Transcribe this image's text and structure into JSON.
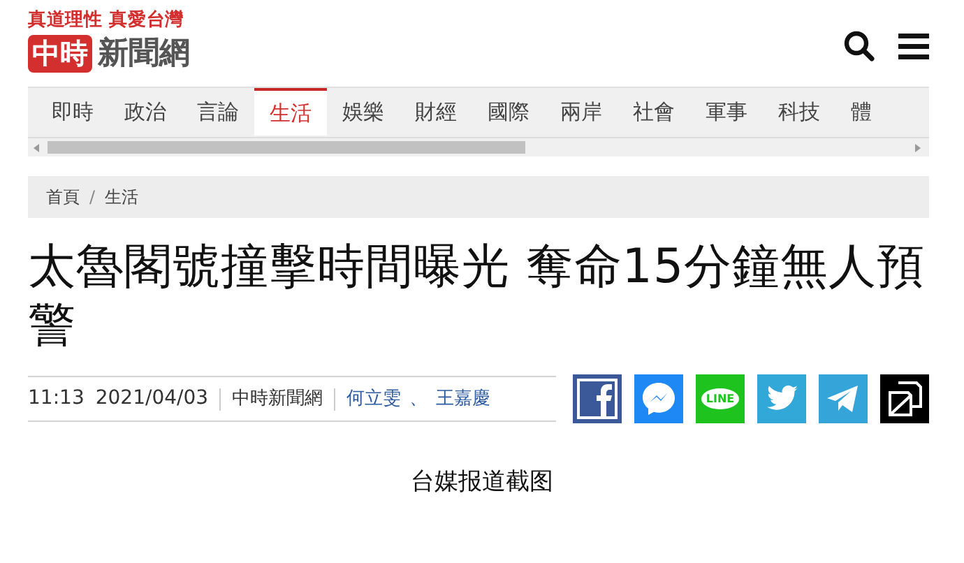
{
  "header": {
    "slogan": "真道理性 真愛台灣",
    "logo_mark": "中時",
    "logo_text": "新聞網"
  },
  "tabs": [
    {
      "label": "即時",
      "selected": false
    },
    {
      "label": "政治",
      "selected": false
    },
    {
      "label": "言論",
      "selected": false
    },
    {
      "label": "生活",
      "selected": true
    },
    {
      "label": "娛樂",
      "selected": false
    },
    {
      "label": "財經",
      "selected": false
    },
    {
      "label": "國際",
      "selected": false
    },
    {
      "label": "兩岸",
      "selected": false
    },
    {
      "label": "社會",
      "selected": false
    },
    {
      "label": "軍事",
      "selected": false
    },
    {
      "label": "科技",
      "selected": false
    },
    {
      "label": "體",
      "selected": false
    }
  ],
  "breadcrumb": [
    "首頁",
    "生活"
  ],
  "breadcrumb_separator": "/",
  "article": {
    "title": "太魯閣號撞擊時間曝光 奪命15分鐘無人預警",
    "time": "11:13",
    "date": "2021/04/03",
    "source": "中時新聞網",
    "authors": [
      "何立雯",
      "王嘉慶"
    ],
    "author_separator": "、"
  },
  "share_buttons": [
    {
      "kind": "facebook",
      "color": "#3b5998"
    },
    {
      "kind": "messenger",
      "color": "#1e88f5"
    },
    {
      "kind": "line",
      "color": "#1ec31e",
      "label": "LINE"
    },
    {
      "kind": "twitter",
      "color": "#31a8d8"
    },
    {
      "kind": "telegram",
      "color": "#35a4d8"
    },
    {
      "kind": "copy",
      "color": "#000000"
    }
  ],
  "caption": "台媒报道截图"
}
